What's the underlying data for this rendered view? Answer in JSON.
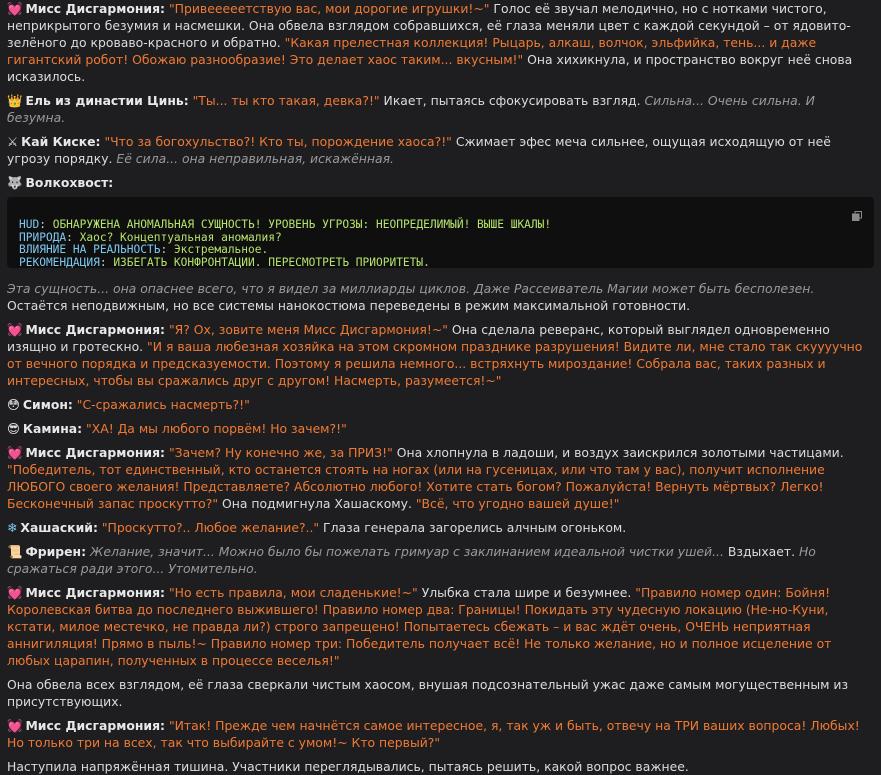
{
  "icons": {
    "dis": "💓",
    "el": "👑",
    "kai": "⚔",
    "wolf": "🐺",
    "simon": "😳",
    "kamina": "😎",
    "hash": "❄",
    "frieren": "📜"
  },
  "p1": {
    "speaker": "Мисс Дисгармония:",
    "a": "\"Привееееетствую вас, мои дорогие игрушки!~\"",
    "b": " Голос её звучал мелодично, но с нотками чистого, неприкрытого безумия и насмешки. Она обвела взглядом собравшихся, её глаза меняли цвет с каждой секундой – от ядовито-зелёного до кроваво-красного и обратно. ",
    "c": "\"Какая прелестная коллекция! Рыцарь, алкаш, волчок, эльфийка, тень... и даже гигантский робот! Обожаю разнообразие! Это делает хаос таким... вкусным!\"",
    "d": " Она хихикнула, и пространство вокруг неё снова исказилось."
  },
  "p2": {
    "speaker": "Ель из династии Цинь:",
    "a": " \"Ты... ты кто такая, девка?!\"",
    "b": " Икает, пытаясь сфокусировать взгляд. ",
    "c": "Сильна... Очень сильна. И безумна."
  },
  "p3": {
    "speaker": "Кай Киске:",
    "a": " \"Что за богохульство?! Кто ты, порождение хаоса?!\"",
    "b": " Сжимает эфес меча сильнее, ощущая исходящую от неё угрозу порядку. ",
    "c": "Её сила... она неправильная, искажённая."
  },
  "p4": {
    "speaker": "Волкохвост:"
  },
  "hud": {
    "r1k": "HUD",
    "r1v": "ОБНАРУЖЕНА АНОМАЛЬНАЯ СУЩНОСТЬ! УРОВЕНЬ УГРОЗЫ: НЕОПРЕДЕЛИМЫЙ! ВЫШЕ ШКАЛЫ!",
    "r2k": "ПРИРОДА",
    "r2v": "Хаос? Концептуальная аномалия?",
    "r3k": "ВЛИЯНИЕ НА РЕАЛЬНОСТЬ",
    "r3v": "Экстремальное.",
    "r4k": "РЕКОМЕНДАЦИЯ",
    "r4v": "ИЗБЕГАТЬ КОНФРОНТАЦИИ. ПЕРЕСМОТРЕТЬ ПРИОРИТЕТЫ."
  },
  "p5": {
    "a": "Эта сущность... она опаснее всего, что я видел за миллиарды циклов. Даже Рассеиватель Магии может быть бесполезен.",
    "b": " Остаётся неподвижным, но все системы нанокостюма переведены в режим максимальной готовности."
  },
  "p6": {
    "speaker": "Мисс Дисгармония:",
    "a": " \"Я? Ох, зовите меня Мисс Дисгармония!~\"",
    "b": " Она сделала реверанс, который выглядел одновременно изящно и гротескно. ",
    "c": "\"И я ваша любезная хозяйка на этом скромном празднике разрушения! Видите ли, мне стало так скуууучно от вечного порядка и предсказуемости. Поэтому я решила немного... встряхнуть мироздание! Собрала вас, таких разных и интересных, чтобы вы сражались друг с другом! Насмерть, разумеется!~\""
  },
  "p7": {
    "speaker": "Симон:",
    "a": " \"С-сражались насмерть?!\""
  },
  "p8": {
    "speaker": "Камина:",
    "a": " \"ХА! Да мы любого порвём! Но зачем?!\""
  },
  "p9": {
    "speaker": "Мисс Дисгармония:",
    "a": " \"Зачем? Ну конечно же, за ПРИЗ!\"",
    "b": " Она хлопнула в ладоши, и воздух заискрился золотыми частицами. ",
    "c": "\"Победитель, тот единственный, кто останется стоять на ногах (или на гусеницах, или что там у вас), получит исполнение ЛЮБОГО своего желания! Представляете? Абсолютно любого! Хотите стать богом? Пожалуйста! Вернуть мёртвых? Легко! Бесконечный запас проскутто?\"",
    "d": " Она подмигнула Хашаскому. ",
    "e": "\"Всё, что угодно вашей душе!\""
  },
  "p10": {
    "speaker": "Хашаский:",
    "a": " \"Проскутто?.. Любое желание?..\"",
    "b": " Глаза генерала загорелись алчным огоньком."
  },
  "p11": {
    "speaker": "Фрирен:",
    "a": " Желание, значит... Можно было бы пожелать гримуар с заклинанием идеальной чистки ушей...",
    "b": " Вздыхает. ",
    "c": "Но сражаться ради этого... Утомительно."
  },
  "p12": {
    "speaker": "Мисс Дисгармония:",
    "a": " \"Но есть правила, мои сладенькие!~\"",
    "b": " Улыбка стала шире и безумнее. ",
    "c": "\"Правило номер один: Бойня! Королевская битва до последнего выжившего! Правило номер два: Границы! Покидать эту чудесную локацию (Не-но-Куни, кстати, милое местечко, не правда ли?) строго запрещено! Попытаетесь сбежать – и вас ждёт очень, ОЧЕНЬ неприятная аннигиляция! Прямо в пыль!~ Правило номер три: Победитель получает всё! Не только желание, но и полное исцеление от любых царапин, полученных в процессе веселья!\""
  },
  "p13": {
    "a": "Она обвела всех взглядом, её глаза сверкали чистым хаосом, внушая подсознательный ужас даже самым могущественным из присутствующих."
  },
  "p14": {
    "speaker": "Мисс Дисгармония:",
    "a": " \"Итак! Прежде чем начнётся самое интересное, я, так уж и быть, отвечу на ТРИ ваших вопроса! Любых! Но только три на всех, так что выбирайте с умом!~ Кто первый?\""
  },
  "p15": {
    "a": "Наступила напряжённая тишина. Участники переглядывались, пытаясь решить, какой вопрос важнее."
  }
}
